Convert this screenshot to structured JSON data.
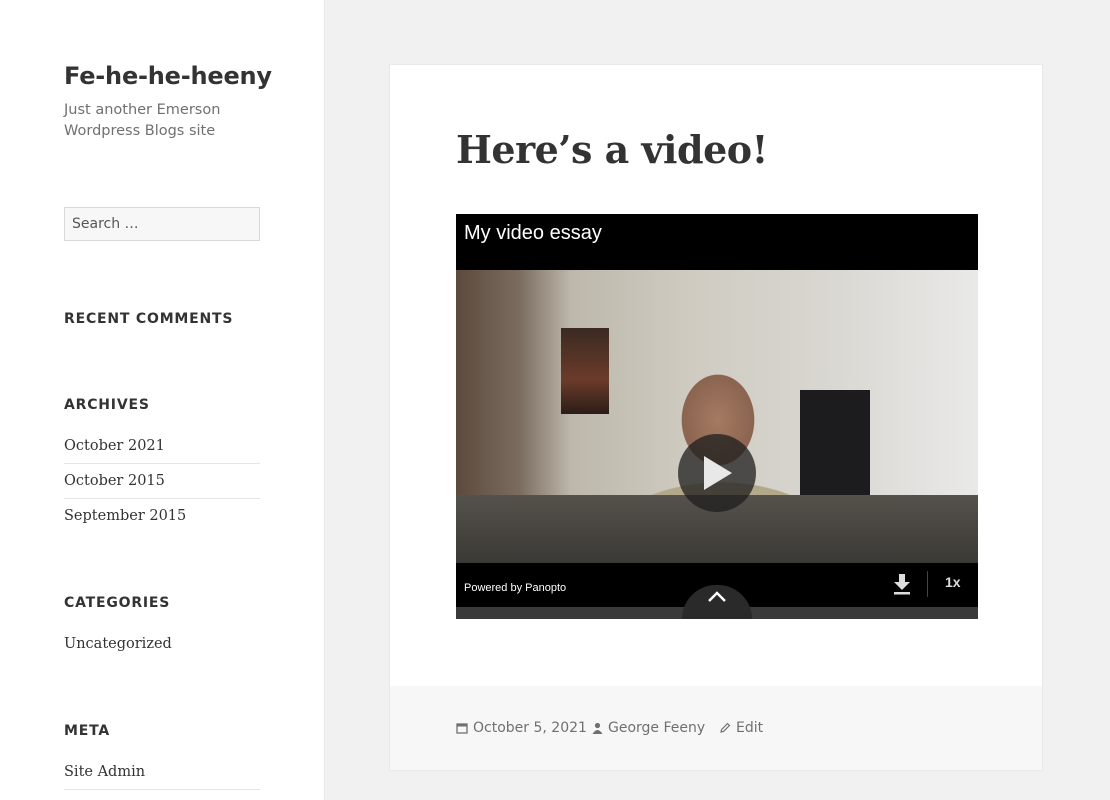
{
  "site": {
    "title": "Fe-he-he-heeny",
    "description": "Just another Emerson Wordpress Blogs site"
  },
  "search": {
    "placeholder": "Search …"
  },
  "widgets": {
    "recent_comments": {
      "title": "RECENT COMMENTS"
    },
    "archives": {
      "title": "ARCHIVES",
      "items": [
        "October 2021",
        "October 2015",
        "September 2015"
      ]
    },
    "categories": {
      "title": "CATEGORIES",
      "items": [
        "Uncategorized"
      ]
    },
    "meta": {
      "title": "META",
      "items": [
        "Site Admin"
      ]
    }
  },
  "post": {
    "title": "Here’s a video!",
    "video": {
      "title": "My video essay",
      "powered_by": "Powered by Panopto",
      "speed": "1x"
    },
    "footer": {
      "date": "October 5, 2021",
      "author": "George Feeny",
      "edit_label": "Edit"
    }
  },
  "icons": {
    "play": "play-icon",
    "download": "download-icon",
    "expand": "chevron-up-icon",
    "date": "calendar-icon",
    "author": "person-icon",
    "edit": "pencil-icon"
  },
  "colors": {
    "sidebar_bg": "#ffffff",
    "page_bg": "#f1f1f1",
    "text": "#333333",
    "muted": "#707070",
    "video_bg": "#000000"
  }
}
